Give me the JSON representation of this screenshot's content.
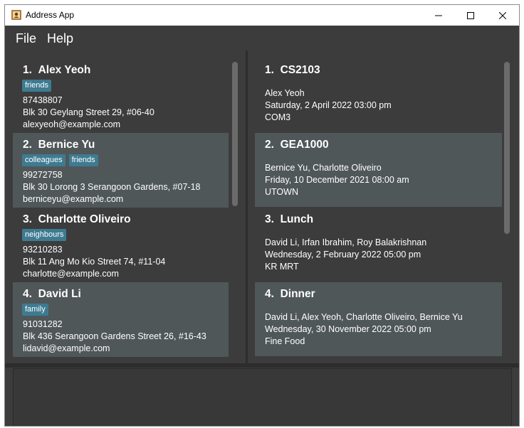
{
  "window": {
    "title": "Address App",
    "icon": "address-book-icon"
  },
  "controls": {
    "minimize": "minimize-icon",
    "maximize": "maximize-icon",
    "close": "close-icon"
  },
  "menu": [
    {
      "label": "File"
    },
    {
      "label": "Help"
    }
  ],
  "persons": [
    {
      "index": "1.",
      "name": "Alex Yeoh",
      "tags": [
        "friends"
      ],
      "phone": "87438807",
      "address": "Blk 30 Geylang Street 29, #06-40",
      "email": "alexyeoh@example.com"
    },
    {
      "index": "2.",
      "name": "Bernice Yu",
      "tags": [
        "colleagues",
        "friends"
      ],
      "phone": "99272758",
      "address": "Blk 30 Lorong 3 Serangoon Gardens, #07-18",
      "email": "berniceyu@example.com"
    },
    {
      "index": "3.",
      "name": "Charlotte Oliveiro",
      "tags": [
        "neighbours"
      ],
      "phone": "93210283",
      "address": "Blk 11 Ang Mo Kio Street 74, #11-04",
      "email": "charlotte@example.com"
    },
    {
      "index": "4.",
      "name": "David Li",
      "tags": [
        "family"
      ],
      "phone": "91031282",
      "address": "Blk 436 Serangoon Gardens Street 26, #16-43",
      "email": "lidavid@example.com"
    }
  ],
  "events": [
    {
      "index": "1.",
      "title": "CS2103",
      "people": "Alex Yeoh",
      "datetime": "Saturday, 2 April 2022 03:00 pm",
      "location": "COM3"
    },
    {
      "index": "2.",
      "title": "GEA1000",
      "people": "Bernice Yu, Charlotte Oliveiro",
      "datetime": "Friday, 10 December 2021 08:00 am",
      "location": "UTOWN"
    },
    {
      "index": "3.",
      "title": "Lunch",
      "people": "David Li, Irfan Ibrahim, Roy Balakrishnan",
      "datetime": "Wednesday, 2 February 2022 05:00 pm",
      "location": "KR MRT"
    },
    {
      "index": "4.",
      "title": "Dinner",
      "people": "David Li, Alex Yeoh, Charlotte Oliveiro, Bernice Yu",
      "datetime": "Wednesday, 30 November 2022 05:00 pm",
      "location": "Fine Food"
    }
  ],
  "result_display": {
    "text": ""
  },
  "colors": {
    "background": "#3c3c3c",
    "alt_row": "#505759",
    "tag": "#3e7b91",
    "text": "#ffffff"
  }
}
